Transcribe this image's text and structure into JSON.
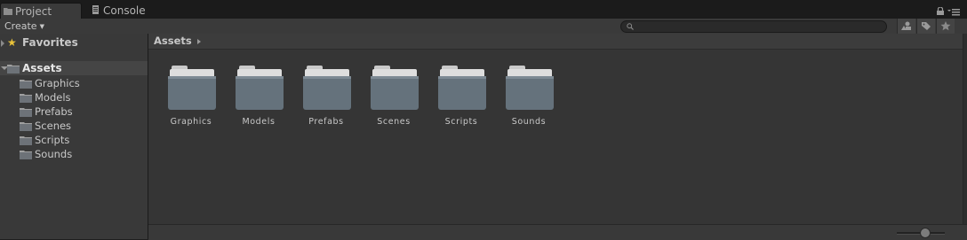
{
  "tabs": [
    {
      "label": "Project",
      "icon": "project-folder-icon",
      "active": true
    },
    {
      "label": "Console",
      "icon": "console-icon",
      "active": false
    }
  ],
  "toolbar": {
    "create_label": "Create",
    "search_value": "",
    "search_placeholder": ""
  },
  "sidebar": {
    "favorites_label": "Favorites",
    "assets_label": "Assets",
    "children": [
      "Graphics",
      "Models",
      "Prefabs",
      "Scenes",
      "Scripts",
      "Sounds"
    ]
  },
  "main": {
    "breadcrumb": "Assets",
    "folders": [
      "Graphics",
      "Models",
      "Prefabs",
      "Scenes",
      "Scripts",
      "Sounds"
    ]
  },
  "zoom": {
    "value": 0.6
  },
  "colors": {
    "favorites_star": "#e8c23a",
    "selected_row": "#454545"
  }
}
